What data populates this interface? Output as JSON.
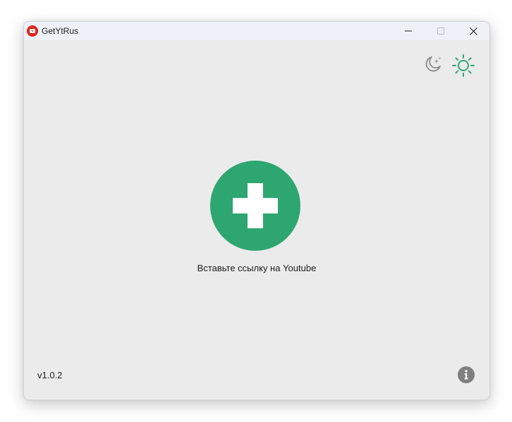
{
  "window": {
    "title": "GetYtRus"
  },
  "titlebar": {
    "app_icon": "youtube-icon",
    "buttons": [
      "minimize-icon",
      "maximize-icon",
      "close-icon"
    ]
  },
  "theme_toggle": {
    "dark_icon": "moon-stars-icon",
    "light_icon": "sun-icon",
    "active": "light"
  },
  "main": {
    "add_icon": "plus-icon",
    "hint": "Вставьте ссылку на Youtube"
  },
  "footer": {
    "version": "v1.0.2",
    "info_icon": "info-icon"
  },
  "colors": {
    "accent": "#2ea671",
    "background": "#ebebeb",
    "titlebar": "#eef2f8",
    "info": "#7f7f7f",
    "moon": "#8a8a8a"
  }
}
